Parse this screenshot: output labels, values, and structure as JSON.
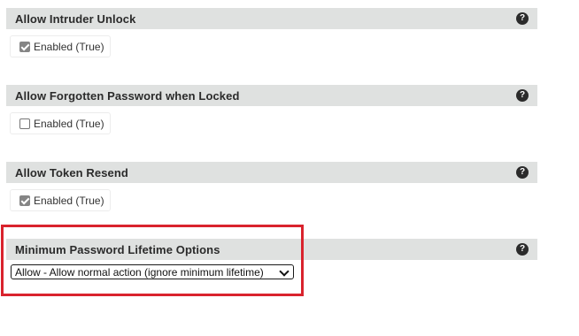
{
  "settings": [
    {
      "title": "Allow Intruder Unlock",
      "type": "checkbox",
      "checked": true,
      "checkbox_label": "Enabled (True)",
      "help_glyph": "?"
    },
    {
      "title": "Allow Forgotten Password when Locked",
      "type": "checkbox",
      "checked": false,
      "checkbox_label": "Enabled (True)",
      "help_glyph": "?"
    },
    {
      "title": "Allow Token Resend",
      "type": "checkbox",
      "checked": true,
      "checkbox_label": "Enabled (True)",
      "help_glyph": "?"
    },
    {
      "title": "Minimum Password Lifetime Options",
      "type": "select",
      "selected_value": "Allow - Allow normal action (ignore minimum lifetime)",
      "help_glyph": "?",
      "highlighted": true
    }
  ],
  "colors": {
    "header_background": "#dfe1e0",
    "highlight_border": "#d9232d",
    "checked_fill": "#858585"
  }
}
